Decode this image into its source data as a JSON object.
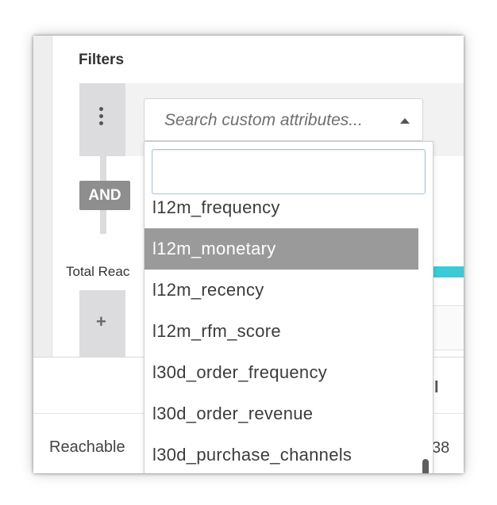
{
  "filters": {
    "title": "Filters",
    "drag_handle_icon": "vertical-dots-icon",
    "connector": "AND",
    "attribute_select": {
      "placeholder": "Search custom attributes...",
      "caret_icon": "caret-up-icon"
    },
    "total_reach_label": "Total Reac",
    "add_filter_icon": "plus-icon"
  },
  "dropdown": {
    "search_value": "",
    "search_placeholder": "",
    "options": [
      "l12m_frequency",
      "l12m_monetary",
      "l12m_recency",
      "l12m_rfm_score",
      "l30d_order_frequency",
      "l30d_order_revenue",
      "l30d_purchase_channels"
    ],
    "highlighted_index": 1
  },
  "footer": {
    "reachable_label": "Reachable",
    "partial_header": "l",
    "partial_count": "38"
  },
  "colors": {
    "highlight": "#9a9a9a",
    "teal_bar": "#3cc9d8",
    "and_badge": "#8e8e8e"
  }
}
